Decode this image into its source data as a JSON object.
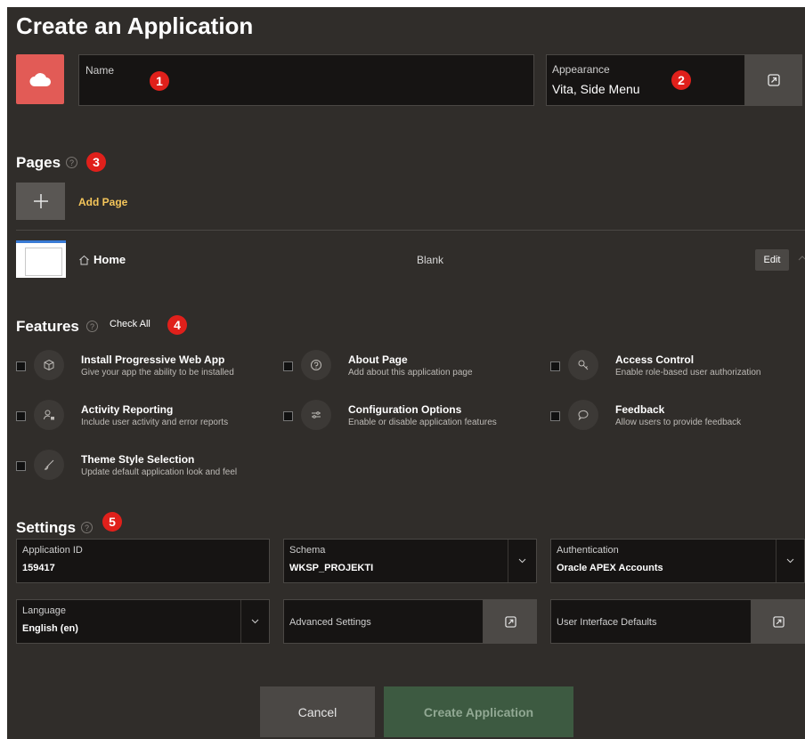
{
  "page": {
    "title": "Create an Application"
  },
  "app": {
    "icon": "cloud-icon",
    "name_label": "Name",
    "name_value": "",
    "appearance_label": "Appearance",
    "appearance_value": "Vita, Side Menu"
  },
  "badges": [
    "1",
    "2",
    "3",
    "4",
    "5"
  ],
  "pages": {
    "heading": "Pages",
    "add_label": "Add Page",
    "items": [
      {
        "name": "Home",
        "type": "Blank",
        "edit_label": "Edit"
      }
    ]
  },
  "features": {
    "heading": "Features",
    "check_all": "Check All",
    "items": [
      {
        "title": "Install Progressive Web App",
        "desc": "Give your app the ability to be installed",
        "icon": "cube-icon"
      },
      {
        "title": "About Page",
        "desc": "Add about this application page",
        "icon": "question-icon"
      },
      {
        "title": "Access Control",
        "desc": "Enable role-based user authorization",
        "icon": "key-icon"
      },
      {
        "title": "Activity Reporting",
        "desc": "Include user activity and error reports",
        "icon": "user-lock-icon"
      },
      {
        "title": "Configuration Options",
        "desc": "Enable or disable application features",
        "icon": "sliders-icon"
      },
      {
        "title": "Feedback",
        "desc": "Allow users to provide feedback",
        "icon": "comment-icon"
      },
      {
        "title": "Theme Style Selection",
        "desc": "Update default application look and feel",
        "icon": "brush-icon"
      }
    ]
  },
  "settings": {
    "heading": "Settings",
    "app_id_label": "Application ID",
    "app_id_value": "159417",
    "schema_label": "Schema",
    "schema_value": "WKSP_PROJEKTI",
    "auth_label": "Authentication",
    "auth_value": "Oracle APEX Accounts",
    "language_label": "Language",
    "language_value": "English (en)",
    "advanced_label": "Advanced Settings",
    "ui_defaults_label": "User Interface Defaults"
  },
  "actions": {
    "cancel": "Cancel",
    "create": "Create Application"
  },
  "colors": {
    "background": "#302d2a",
    "accent": "#e25b56",
    "badge": "#e0201b",
    "link": "#f4c55a",
    "create_button": "#3d5a41"
  }
}
